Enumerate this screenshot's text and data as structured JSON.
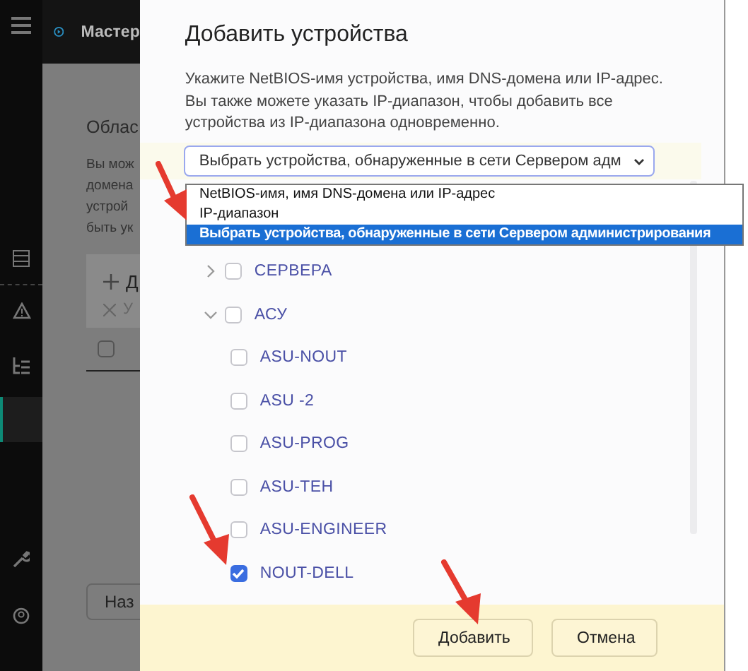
{
  "sidebar": {
    "items": [
      {
        "kind": "menu",
        "selected": false
      },
      {
        "kind": "list",
        "selected": false
      },
      {
        "kind": "alert",
        "selected": false
      },
      {
        "kind": "tree",
        "selected": false
      },
      {
        "kind": "blank",
        "selected": true
      },
      {
        "kind": "tools",
        "selected": false
      },
      {
        "kind": "account",
        "selected": false
      }
    ]
  },
  "background": {
    "header_title": "Мастер",
    "section_title": "Облас",
    "description_lines": [
      "Вы мож",
      "домена",
      "устрой",
      "быть ук"
    ],
    "add_action": "Д",
    "remove_action": "У",
    "next_button": "Наз",
    "select_all_checked": false
  },
  "dialog": {
    "title": "Добавить устройства",
    "description": "Укажите NetBIOS-имя устройства, имя DNS-домена или IP-адрес. Вы также можете указать IP-диапазон, чтобы добавить все устройства из IP-диапазона одновременно.",
    "select": {
      "value": "Выбрать устройства, обнаруженные в сети Сервером адм",
      "expanded": true,
      "options": [
        {
          "label": "NetBIOS-имя, имя DNS-домена или IP-адрес",
          "selected": false
        },
        {
          "label": "IP-диапазон",
          "selected": false
        },
        {
          "label": "Выбрать устройства, обнаруженные в сети Сервером администрирования",
          "selected": true
        }
      ]
    },
    "tree": [
      {
        "label": "СЕРВЕРА",
        "expanded": false,
        "checked": false
      },
      {
        "label": "АСУ",
        "expanded": true,
        "checked": false,
        "children": [
          {
            "label": "ASU-NOUT",
            "checked": false
          },
          {
            "label": "ASU -2",
            "checked": false
          },
          {
            "label": "ASU-PROG",
            "checked": false
          },
          {
            "label": "ASU-TEH",
            "checked": false
          },
          {
            "label": "ASU-ENGINEER",
            "checked": false
          },
          {
            "label": "NOUT-DELL",
            "checked": true
          }
        ]
      }
    ],
    "buttons": [
      "Добавить",
      "Отмена"
    ]
  }
}
